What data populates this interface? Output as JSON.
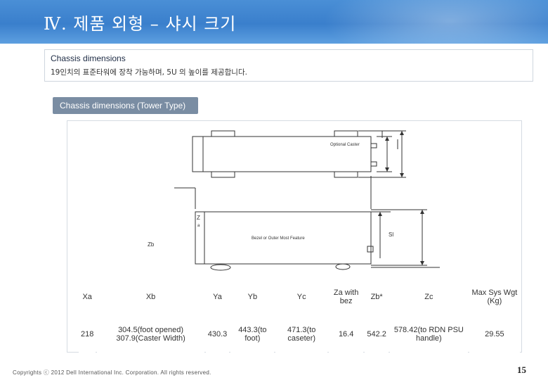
{
  "header": {
    "title": "Ⅳ. 제품 외형 – 샤시 크기"
  },
  "info": {
    "title": "Chassis dimensions",
    "subtitle": "19인치의 표준타워에 장착 가능하며, 5U 의 높이를 제공합니다."
  },
  "section": {
    "label": "Chassis dimensions (Tower Type)"
  },
  "drawing": {
    "label_caster": "Optional Caster",
    "label_bezel": "Bezel or Outer Most Feature",
    "label_z": "Z",
    "label_a": "a",
    "label_zb": "Zb",
    "label_sl": "Sl"
  },
  "table": {
    "headers": [
      "Xa",
      "Xb",
      "Ya",
      "Yb",
      "Yc",
      "Za with bez",
      "Zb*",
      "Zc",
      "Max Sys Wgt (Kg)"
    ],
    "values": [
      "218",
      "304.5(foot opened) 307.9(Caster Width)",
      "430.3",
      "443.3(to foot)",
      "471.3(to caseter)",
      "16.4",
      "542.2",
      "578.42(to RDN PSU handle)",
      "29.55"
    ]
  },
  "footer": {
    "copyright": "Copyrights ⓒ 2012 Dell International Inc. Corporation. All rights reserved.",
    "page": "15"
  }
}
